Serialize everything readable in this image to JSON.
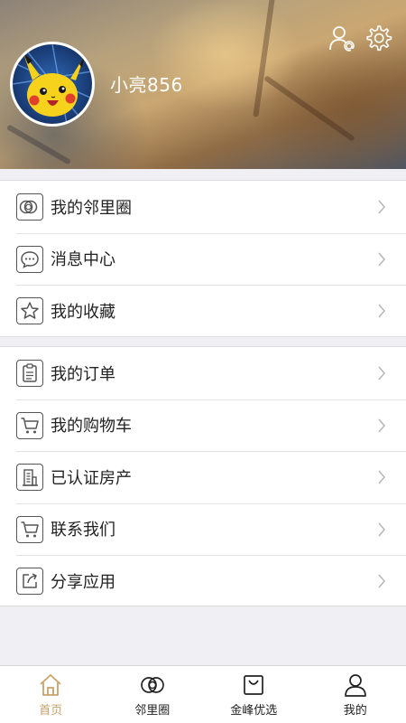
{
  "profile": {
    "username": "小亮856"
  },
  "menu_group_1": [
    {
      "label": "我的邻里圈",
      "icon": "rings-icon"
    },
    {
      "label": "消息中心",
      "icon": "message-icon"
    },
    {
      "label": "我的收藏",
      "icon": "star-icon"
    }
  ],
  "menu_group_2": [
    {
      "label": "我的订单",
      "icon": "clipboard-icon"
    },
    {
      "label": "我的购物车",
      "icon": "cart-icon"
    },
    {
      "label": "已认证房产",
      "icon": "building-icon"
    },
    {
      "label": "联系我们",
      "icon": "cart-icon"
    },
    {
      "label": "分享应用",
      "icon": "share-icon"
    }
  ],
  "tabbar": {
    "items": [
      {
        "label": "首页",
        "icon": "home-icon",
        "active": true
      },
      {
        "label": "邻里圈",
        "icon": "rings-icon",
        "active": false
      },
      {
        "label": "金峰优选",
        "icon": "bag-icon",
        "active": false
      },
      {
        "label": "我的",
        "icon": "person-icon",
        "active": false
      }
    ]
  },
  "colors": {
    "accent": "#c8a26a",
    "background": "#efeff4",
    "text": "#222222",
    "icon_stroke": "#555555"
  }
}
